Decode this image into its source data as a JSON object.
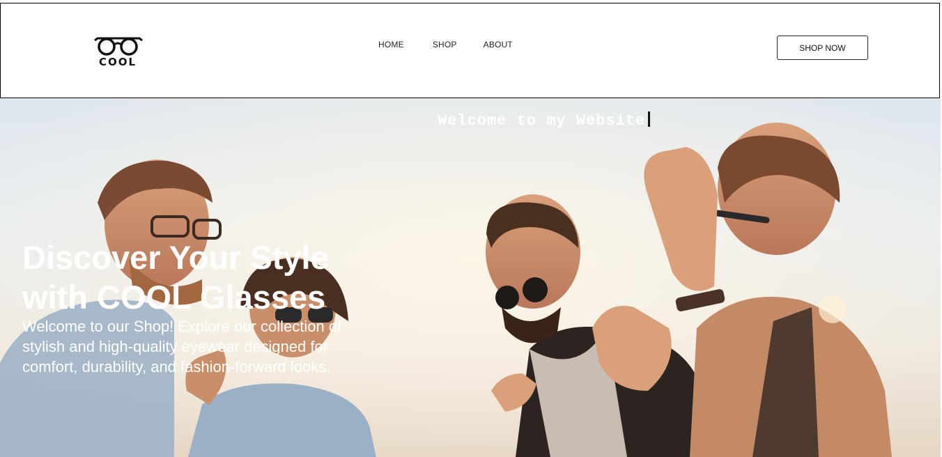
{
  "header": {
    "logo_text": "COOL",
    "nav": {
      "home": "HOME",
      "shop": "SHOP",
      "about": "ABOUT"
    },
    "cta_label": "SHOP NOW"
  },
  "hero": {
    "typed_heading": "Welcome to my Website",
    "title": "Discover Your Style with COOL Glasses",
    "description": "Welcome to our Shop! Explore our collection of stylish and high-quality eyewear designed for comfort, durability, and fashion-forward looks.",
    "photo_subject": "group of friends laughing outdoors wearing glasses"
  },
  "colors": {
    "header_border": "#000000",
    "hero_text": "#ffffff",
    "sky": "#e4eaef"
  }
}
